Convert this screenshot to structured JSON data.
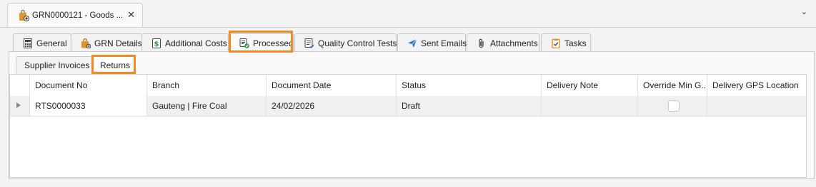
{
  "document_tab": {
    "title": "GRN0000121 - Goods ...",
    "close": "✕",
    "icon": "bag-plus-icon"
  },
  "strip_chevron": "⌄",
  "tabs": [
    {
      "label": "General",
      "icon": "calculator-icon"
    },
    {
      "label": "GRN Details",
      "icon": "bag-icon"
    },
    {
      "label": "Additional Costs",
      "icon": "dollar-icon"
    },
    {
      "label": "Processed",
      "icon": "check-document-icon",
      "active": true
    },
    {
      "label": "Quality Control Tests",
      "icon": "checklist-icon"
    },
    {
      "label": "Sent Emails",
      "icon": "send-icon"
    },
    {
      "label": "Attachments",
      "icon": "paperclip-icon"
    },
    {
      "label": "Tasks",
      "icon": "clipboard-check-icon"
    }
  ],
  "subtabs": [
    {
      "label": "Supplier Invoices"
    },
    {
      "label": "Returns",
      "active": true
    }
  ],
  "grid": {
    "columns": [
      "Document No",
      "Branch",
      "Document Date",
      "Status",
      "Delivery Note",
      "Override Min G...",
      "Delivery GPS Location"
    ],
    "rows": [
      {
        "document_no": "RTS0000033",
        "branch": "Gauteng | Fire Coal",
        "document_date": "24/02/2026",
        "status": "Draft",
        "delivery_note": "",
        "override_min": false,
        "gps": ""
      }
    ]
  },
  "colors": {
    "highlight": "#f08a24",
    "accent_orange": "#e0962e",
    "accent_blue": "#2a6fd1",
    "check_green": "#2e9b47"
  }
}
